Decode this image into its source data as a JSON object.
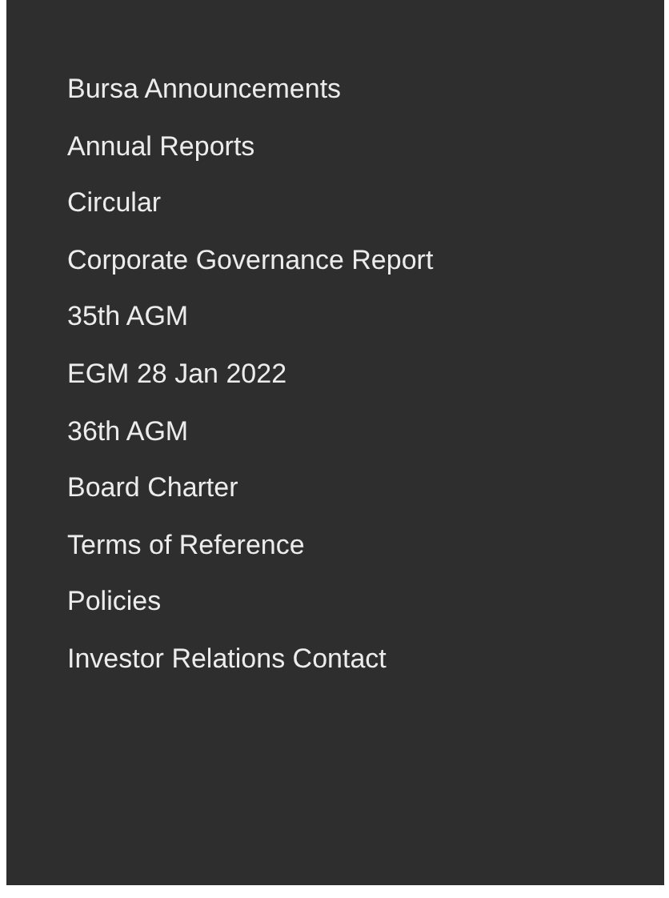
{
  "menu": {
    "items": [
      {
        "label": "Bursa Announcements"
      },
      {
        "label": "Annual Reports"
      },
      {
        "label": "Circular"
      },
      {
        "label": "Corporate Governance Report"
      },
      {
        "label": "35th AGM"
      },
      {
        "label": "EGM 28 Jan 2022"
      },
      {
        "label": "36th AGM"
      },
      {
        "label": "Board Charter"
      },
      {
        "label": "Terms of Reference"
      },
      {
        "label": "Policies"
      },
      {
        "label": "Investor Relations Contact"
      }
    ]
  }
}
